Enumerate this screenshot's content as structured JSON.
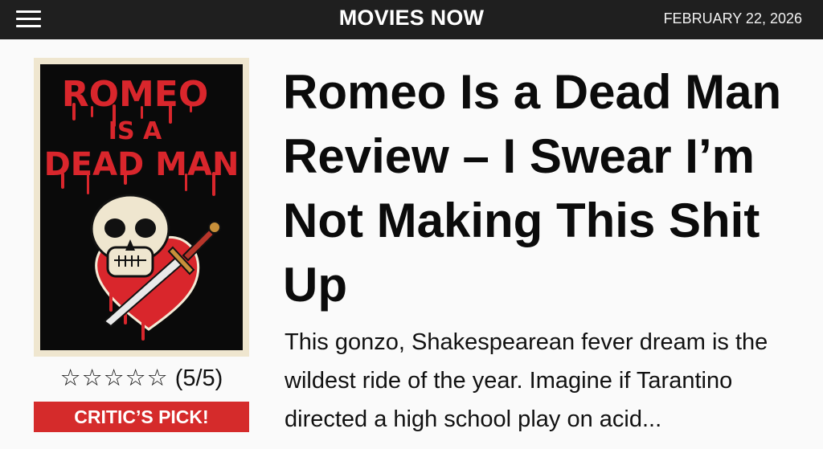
{
  "header": {
    "site_title": "MOVIES NOW",
    "date": "FEBRUARY 22, 2026",
    "menu_icon": "hamburger-menu-icon"
  },
  "poster": {
    "line1": "ROMEO",
    "line2": "IS A",
    "line3": "DEAD MAN",
    "title_color": "#d9262c",
    "background_color": "#0a0a0a",
    "frame_color": "#efe6cf"
  },
  "review": {
    "rating_stars": "☆☆☆☆☆",
    "rating_text": "(5/5)",
    "badge": "CRITIC’S PICK!",
    "badge_color": "#d52b2b",
    "headline": "Romeo Is a Dead Man Review – I Swear I’m Not Making This Shit Up",
    "summary": "This gonzo, Shakespearean fever dream is the wildest ride of the year. Imagine if Tarantino directed a high school play on acid..."
  }
}
